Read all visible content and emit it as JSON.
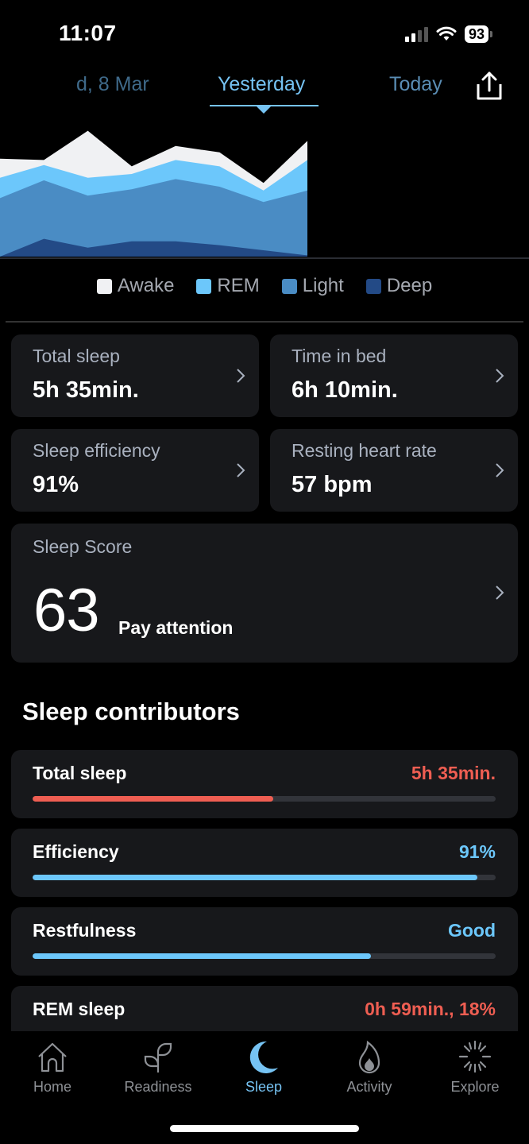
{
  "status_bar": {
    "time": "11:07",
    "battery": "93",
    "icons": [
      "cellular-signal-icon",
      "wifi-icon",
      "battery-icon"
    ]
  },
  "date_tabs": {
    "prev": "d, 8 Mar",
    "active": "Yesterday",
    "next": "Today",
    "share_icon": "share-icon"
  },
  "chart_data": {
    "type": "area",
    "stacked": true,
    "title": "",
    "xlabel": "",
    "ylabel": "",
    "x": [
      0,
      1,
      2,
      3,
      4,
      5,
      6,
      7
    ],
    "ylim": [
      0,
      100
    ],
    "grid": false,
    "legend_position": "bottom",
    "series": [
      {
        "name": "Deep",
        "color": "#234a86",
        "values": [
          0,
          14,
          7,
          12,
          12,
          9,
          5,
          1
        ]
      },
      {
        "name": "Light",
        "color": "#4a8cc4",
        "values": [
          46,
          46,
          41,
          41,
          49,
          46,
          38,
          51
        ]
      },
      {
        "name": "REM",
        "color": "#6cc7fb",
        "values": [
          16,
          12,
          14,
          12,
          15,
          16,
          9,
          24
        ]
      },
      {
        "name": "Awake",
        "color": "#f0f1f3",
        "values": [
          15,
          4,
          37,
          6,
          11,
          11,
          6,
          15
        ]
      }
    ]
  },
  "legend": [
    {
      "label": "Awake",
      "color": "#f0f1f3"
    },
    {
      "label": "REM",
      "color": "#6cc7fb"
    },
    {
      "label": "Light",
      "color": "#4a8cc4"
    },
    {
      "label": "Deep",
      "color": "#234a86"
    }
  ],
  "metrics": {
    "total_sleep": {
      "label": "Total sleep",
      "value": "5h 35min."
    },
    "time_in_bed": {
      "label": "Time in bed",
      "value": "6h 10min."
    },
    "sleep_efficiency": {
      "label": "Sleep efficiency",
      "value": "91%"
    },
    "resting_hr": {
      "label": "Resting heart rate",
      "value": "57 bpm"
    }
  },
  "sleep_score": {
    "label": "Sleep Score",
    "value": "63",
    "status": "Pay attention"
  },
  "contributors": {
    "title": "Sleep contributors",
    "items": [
      {
        "label": "Total sleep",
        "value": "5h 35min.",
        "progress": 0.52,
        "color": "#ef5e52"
      },
      {
        "label": "Efficiency",
        "value": "91%",
        "progress": 0.96,
        "color": "#6cc7fb"
      },
      {
        "label": "Restfulness",
        "value": "Good",
        "progress": 0.73,
        "color": "#6cc7fb"
      },
      {
        "label": "REM sleep",
        "value": "0h 59min., 18%",
        "progress": null,
        "color": "#ef5e52"
      }
    ]
  },
  "nav": {
    "items": [
      {
        "label": "Home",
        "icon": "home-icon",
        "active": false
      },
      {
        "label": "Readiness",
        "icon": "sprout-icon",
        "active": false
      },
      {
        "label": "Sleep",
        "icon": "moon-icon",
        "active": true
      },
      {
        "label": "Activity",
        "icon": "flame-icon",
        "active": false
      },
      {
        "label": "Explore",
        "icon": "sparkle-icon",
        "active": false
      }
    ]
  },
  "colors": {
    "accent": "#76c3f3",
    "warning": "#ef5e52",
    "card_bg": "#17181b"
  }
}
